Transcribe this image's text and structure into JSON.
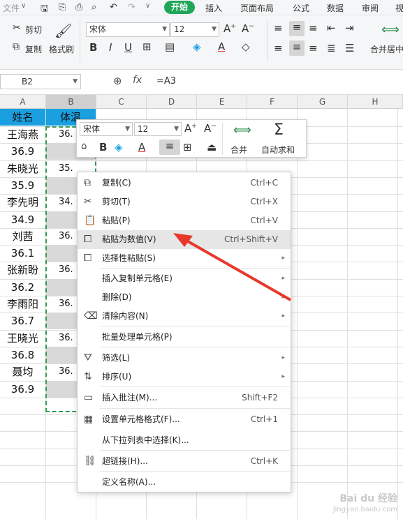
{
  "menubar": {
    "file_label": "文件",
    "tabs": [
      "开始",
      "插入",
      "页面布局",
      "公式",
      "数据",
      "审阅",
      "视"
    ]
  },
  "ribbon": {
    "cut": "剪切",
    "copy": "复制",
    "format_painter": "格式刷",
    "font": "宋体",
    "size": "12",
    "merge": "合并居中"
  },
  "formula": {
    "cell_ref": "B2",
    "fx": "fx",
    "value": "=A3"
  },
  "columns": [
    "A",
    "B",
    "C",
    "D",
    "E",
    "F",
    "G",
    "H"
  ],
  "table": {
    "header_a": "姓名",
    "header_b": "体温",
    "rows": [
      {
        "a": "王海燕",
        "b": "36."
      },
      {
        "a": "36.9",
        "b": ""
      },
      {
        "a": "朱晓光",
        "b": "35."
      },
      {
        "a": "35.9",
        "b": ""
      },
      {
        "a": "李先明",
        "b": "34."
      },
      {
        "a": "34.9",
        "b": ""
      },
      {
        "a": "刘茜",
        "b": "36."
      },
      {
        "a": "36.1",
        "b": ""
      },
      {
        "a": "张新盼",
        "b": "36."
      },
      {
        "a": "36.2",
        "b": ""
      },
      {
        "a": "李雨阳",
        "b": "36."
      },
      {
        "a": "36.7",
        "b": ""
      },
      {
        "a": "王晓光",
        "b": "36."
      },
      {
        "a": "36.8",
        "b": ""
      },
      {
        "a": "聂均",
        "b": "36."
      },
      {
        "a": "36.9",
        "b": ""
      }
    ]
  },
  "mini_toolbar": {
    "font": "宋体",
    "size": "12",
    "merge": "合并",
    "autosum": "自动求和"
  },
  "context_menu": [
    {
      "label": "复制(C)",
      "shortcut": "Ctrl+C",
      "icon": "copy-icon"
    },
    {
      "label": "剪切(T)",
      "shortcut": "Ctrl+X",
      "icon": "scissors-icon"
    },
    {
      "label": "粘贴(P)",
      "shortcut": "Ctrl+V",
      "icon": "paste-icon"
    },
    {
      "label": "粘贴为数值(V)",
      "shortcut": "Ctrl+Shift+V",
      "icon": "paste-values-icon"
    },
    {
      "label": "选择性粘贴(S)",
      "shortcut": "",
      "icon": "paste-special-icon"
    },
    {
      "label": "插入复制单元格(E)",
      "shortcut": "",
      "icon": ""
    },
    {
      "label": "删除(D)",
      "shortcut": "",
      "icon": ""
    },
    {
      "label": "清除内容(N)",
      "shortcut": "",
      "icon": "eraser-icon"
    },
    {
      "label": "批量处理单元格(P)",
      "shortcut": "",
      "icon": ""
    },
    {
      "label": "筛选(L)",
      "shortcut": "",
      "icon": "filter-icon"
    },
    {
      "label": "排序(U)",
      "shortcut": "",
      "icon": "sort-icon"
    },
    {
      "label": "插入批注(M)...",
      "shortcut": "Shift+F2",
      "icon": "comment-icon"
    },
    {
      "label": "设置单元格格式(F)...",
      "shortcut": "Ctrl+1",
      "icon": "format-cells-icon"
    },
    {
      "label": "从下拉列表中选择(K)...",
      "shortcut": "",
      "icon": ""
    },
    {
      "label": "超链接(H)...",
      "shortcut": "Ctrl+K",
      "icon": "link-icon"
    },
    {
      "label": "定义名称(A)...",
      "shortcut": "",
      "icon": ""
    }
  ],
  "watermark": {
    "line1": "Bai du 经验",
    "line2": "jingyan.baidu.com"
  },
  "colors": {
    "accent": "#1fa659",
    "header_fill": "#1aa0e0",
    "arrow": "#e8382b"
  }
}
